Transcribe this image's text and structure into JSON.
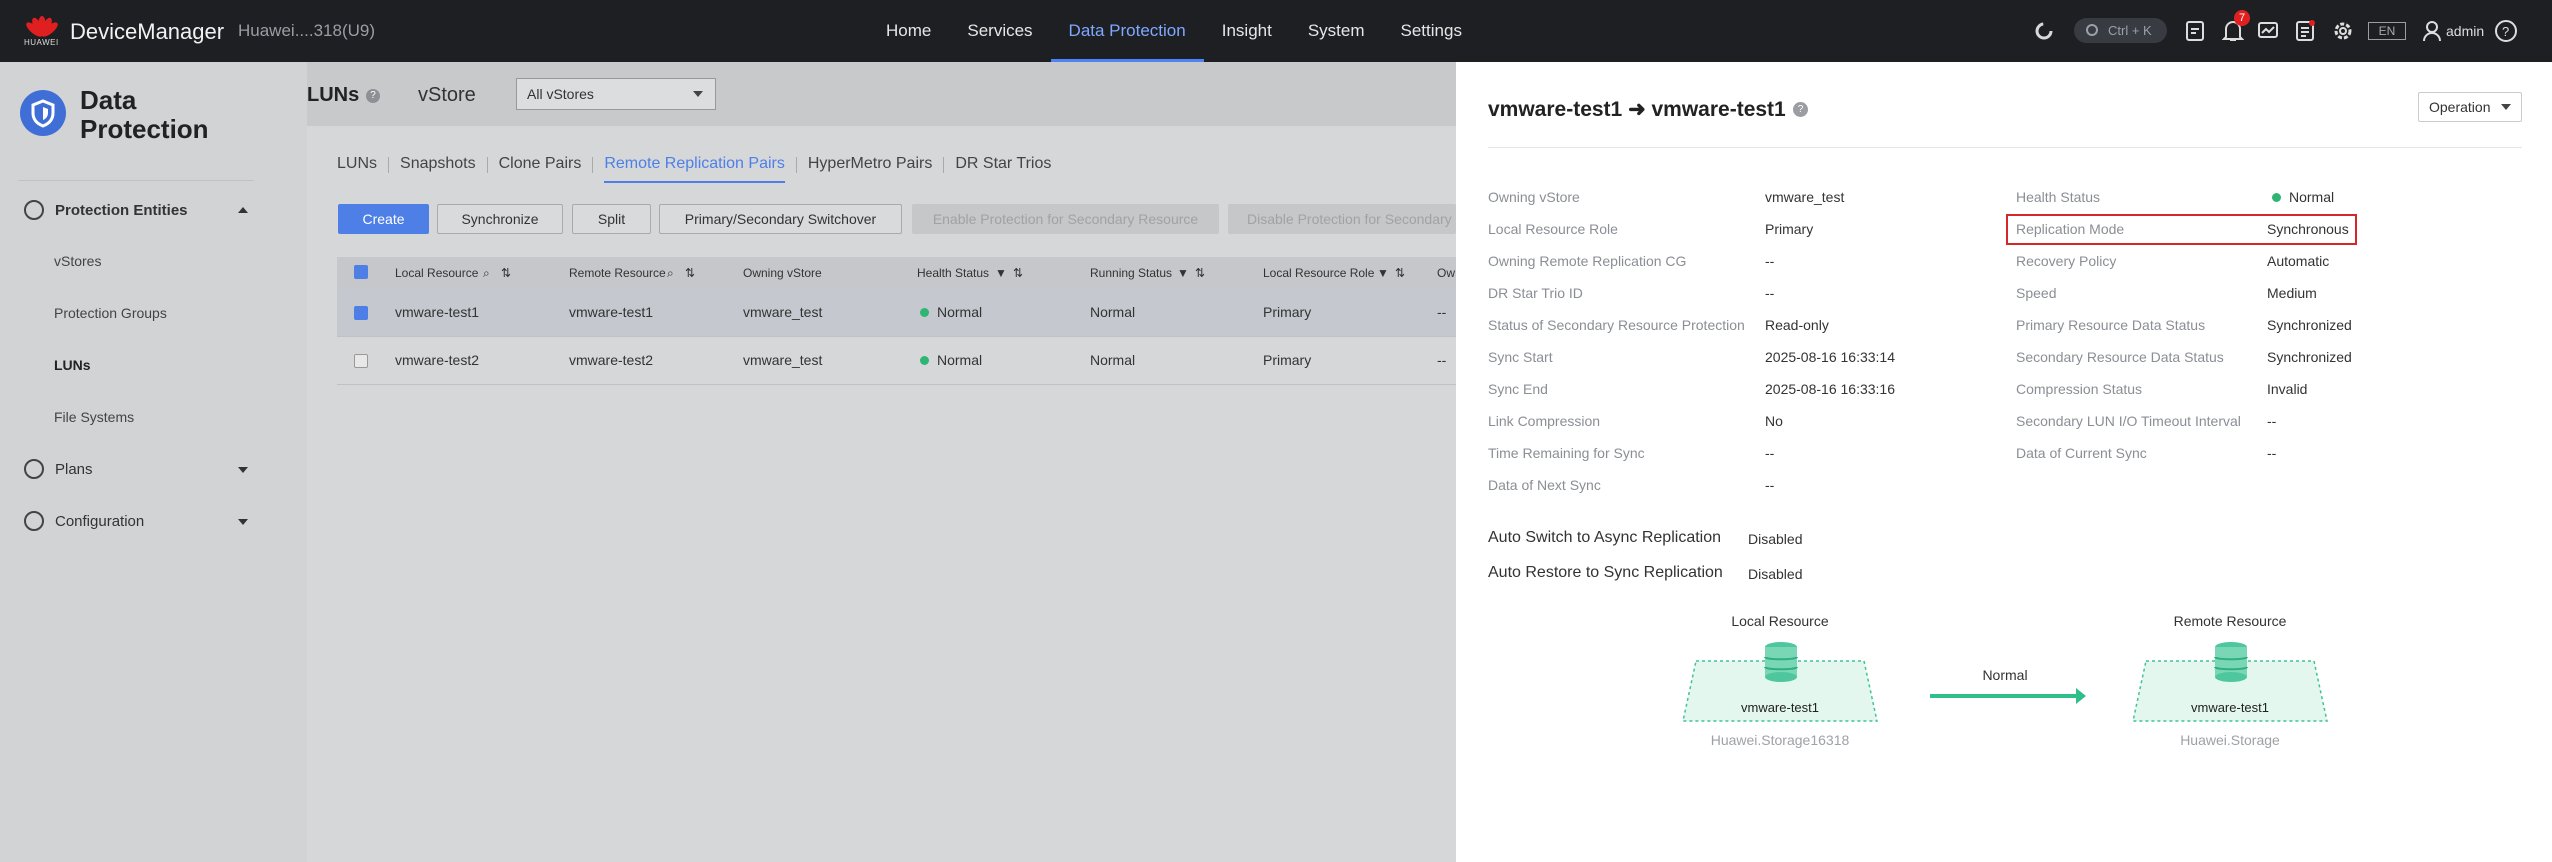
{
  "topbar": {
    "brand_sub": "HUAWEI",
    "brand": "DeviceManager",
    "device": "Huawei....318(U9)",
    "nav": [
      "Home",
      "Services",
      "Data Protection",
      "Insight",
      "System",
      "Settings"
    ],
    "active_nav": "Data Protection",
    "search_shortcut": "Ctrl + K",
    "alert_count": "7",
    "lang": "EN",
    "user": "admin",
    "accent": "#4f82f5"
  },
  "sidebar": {
    "title_line1": "Data",
    "title_line2": "Protection",
    "section": "Protection Entities",
    "items": [
      "vStores",
      "Protection Groups",
      "LUNs",
      "File Systems"
    ],
    "active_item": "LUNs",
    "plans": "Plans",
    "configuration": "Configuration"
  },
  "content": {
    "title": "LUNs",
    "vstore_label": "vStore",
    "vstore_select": "All vStores",
    "tabs": [
      "LUNs",
      "Snapshots",
      "Clone Pairs",
      "Remote Replication Pairs",
      "HyperMetro Pairs",
      "DR Star Trios"
    ],
    "active_tab": "Remote Replication Pairs",
    "buttons": {
      "create": "Create",
      "synchronize": "Synchronize",
      "split": "Split",
      "switchover": "Primary/Secondary Switchover",
      "enable_protection": "Enable Protection for Secondary Resource",
      "disable_protection": "Disable Protection for Secondary"
    },
    "columns": [
      "Local Resource",
      "Remote Resource",
      "Owning vStore",
      "Health Status",
      "Running Status",
      "Local Resource Role",
      "Ow"
    ],
    "rows": [
      {
        "local": "vmware-test1",
        "remote": "vmware-test1",
        "vstore": "vmware_test",
        "health": "Normal",
        "running": "Normal",
        "role": "Primary",
        "extra": "--",
        "selected": true
      },
      {
        "local": "vmware-test2",
        "remote": "vmware-test2",
        "vstore": "vmware_test",
        "health": "Normal",
        "running": "Normal",
        "role": "Primary",
        "extra": "--",
        "selected": false
      }
    ]
  },
  "detail": {
    "title": "vmware-test1 ➜ vmware-test1",
    "operation": "Operation",
    "left": [
      {
        "k": "Owning vStore",
        "v": "vmware_test"
      },
      {
        "k": "Local Resource Role",
        "v": "Primary"
      },
      {
        "k": "Owning Remote Replication CG",
        "v": "--"
      },
      {
        "k": "DR Star Trio ID",
        "v": "--"
      },
      {
        "k": "Status of Secondary Resource Protection",
        "v": "Read-only"
      },
      {
        "k": "Sync Start",
        "v": "2025-08-16 16:33:14"
      },
      {
        "k": "Sync End",
        "v": "2025-08-16 16:33:16"
      },
      {
        "k": "Link Compression",
        "v": "No"
      },
      {
        "k": "Time Remaining for Sync",
        "v": "--"
      },
      {
        "k": "Data of Next Sync",
        "v": "--"
      }
    ],
    "right": [
      {
        "k": "Health Status",
        "v": "Normal"
      },
      {
        "k": "Replication Mode",
        "v": "Synchronous"
      },
      {
        "k": "Recovery Policy",
        "v": "Automatic"
      },
      {
        "k": "Speed",
        "v": "Medium"
      },
      {
        "k": "Primary Resource Data Status",
        "v": "Synchronized"
      },
      {
        "k": "Secondary Resource Data Status",
        "v": "Synchronized"
      },
      {
        "k": "Compression Status",
        "v": "Invalid"
      },
      {
        "k": "Secondary LUN I/O Timeout Interval",
        "v": "--"
      },
      {
        "k": "Data of Current Sync",
        "v": "--"
      }
    ],
    "auto_switch_label": "Auto Switch to Async Replication",
    "auto_switch_value": "Disabled",
    "auto_restore_label": "Auto Restore to Sync Replication",
    "auto_restore_value": "Disabled",
    "diagram": {
      "local_label": "Local Resource",
      "remote_label": "Remote Resource",
      "link_status": "Normal",
      "local_name": "vmware-test1",
      "remote_name": "vmware-test1",
      "local_device": "Huawei.Storage16318",
      "remote_device": "Huawei.Storage"
    }
  }
}
